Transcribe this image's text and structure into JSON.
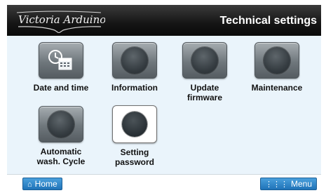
{
  "header": {
    "brand": "Victoria Arduino",
    "title": "Technical settings"
  },
  "tiles": [
    {
      "label": "Date and time",
      "icon": "calendar-clock-icon"
    },
    {
      "label": "Information",
      "icon": "circle-icon"
    },
    {
      "label": "Update\nfirmware",
      "icon": "circle-icon"
    },
    {
      "label": "Maintenance",
      "icon": "circle-icon"
    },
    {
      "label": "Automatic\nwash. Cycle",
      "icon": "circle-icon"
    },
    {
      "label": "Setting\npassword",
      "icon": "circle-icon"
    }
  ],
  "footer": {
    "home_label": "Home",
    "menu_label": "Menu"
  },
  "colors": {
    "topbar": "#151515",
    "screen_background": "#eaf4fb",
    "button_blue": "#1f73b8"
  }
}
